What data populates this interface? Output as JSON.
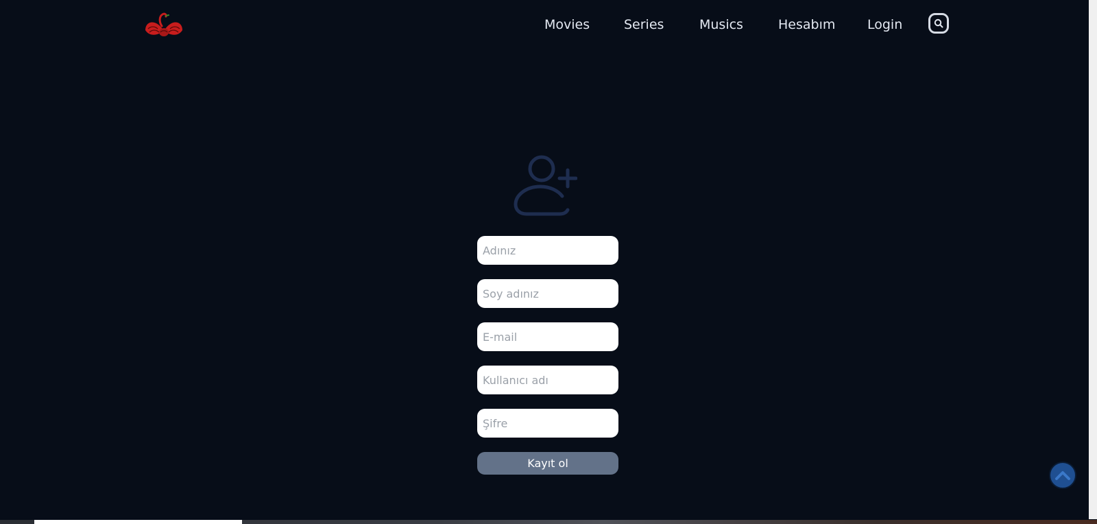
{
  "header": {
    "logo_name": "red-swan-logo",
    "nav": [
      {
        "label": "Movies"
      },
      {
        "label": "Series"
      },
      {
        "label": "Musics"
      },
      {
        "label": "Hesabım"
      },
      {
        "label": "Login"
      }
    ],
    "search_icon": "search-icon"
  },
  "form": {
    "icon": "user-plus-icon",
    "fields": [
      {
        "placeholder": "Adınız",
        "value": ""
      },
      {
        "placeholder": "Soy adınız",
        "value": ""
      },
      {
        "placeholder": "E-mail",
        "value": ""
      },
      {
        "placeholder": "Kullanıcı adı",
        "value": ""
      },
      {
        "placeholder": "Şifre",
        "value": ""
      }
    ],
    "submit_label": "Kayıt ol"
  },
  "scroll_top_icon": "chevron-up-icon",
  "colors": {
    "background": "#070d18",
    "nav_text": "#e4e9f2",
    "submit_button": "#637289",
    "scroll_top": "#1f4f91",
    "icon": "#1e2d4f",
    "logo": "#d42020"
  }
}
